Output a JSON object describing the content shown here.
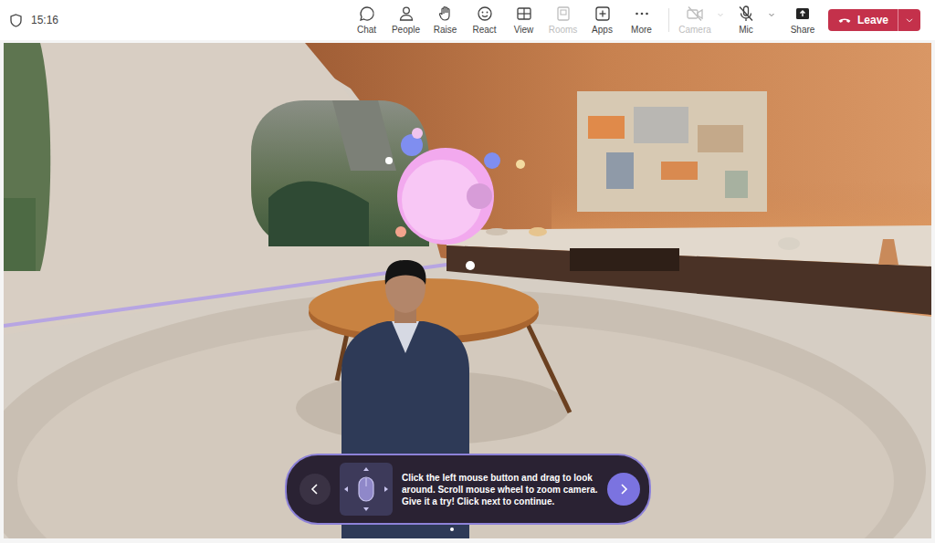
{
  "clock": "15:16",
  "toolbar": [
    {
      "label": "Chat",
      "disabled": false
    },
    {
      "label": "People",
      "disabled": false
    },
    {
      "label": "Raise",
      "disabled": false
    },
    {
      "label": "React",
      "disabled": false
    },
    {
      "label": "View",
      "disabled": false
    },
    {
      "label": "Rooms",
      "disabled": true
    },
    {
      "label": "Apps",
      "disabled": false
    },
    {
      "label": "More",
      "disabled": false
    }
  ],
  "devices": [
    {
      "label": "Camera",
      "kind": "camera",
      "off": true,
      "disabled": true
    },
    {
      "label": "Mic",
      "kind": "mic",
      "off": true,
      "disabled": false
    }
  ],
  "share": {
    "label": "Share"
  },
  "leave": {
    "label": "Leave"
  },
  "tutorial": {
    "text": "Click the left mouse button and drag to look around. Scroll mouse wheel to zoom camera. Give it a try! Click next to continue.",
    "pages": [
      {
        "selected": true
      }
    ]
  }
}
